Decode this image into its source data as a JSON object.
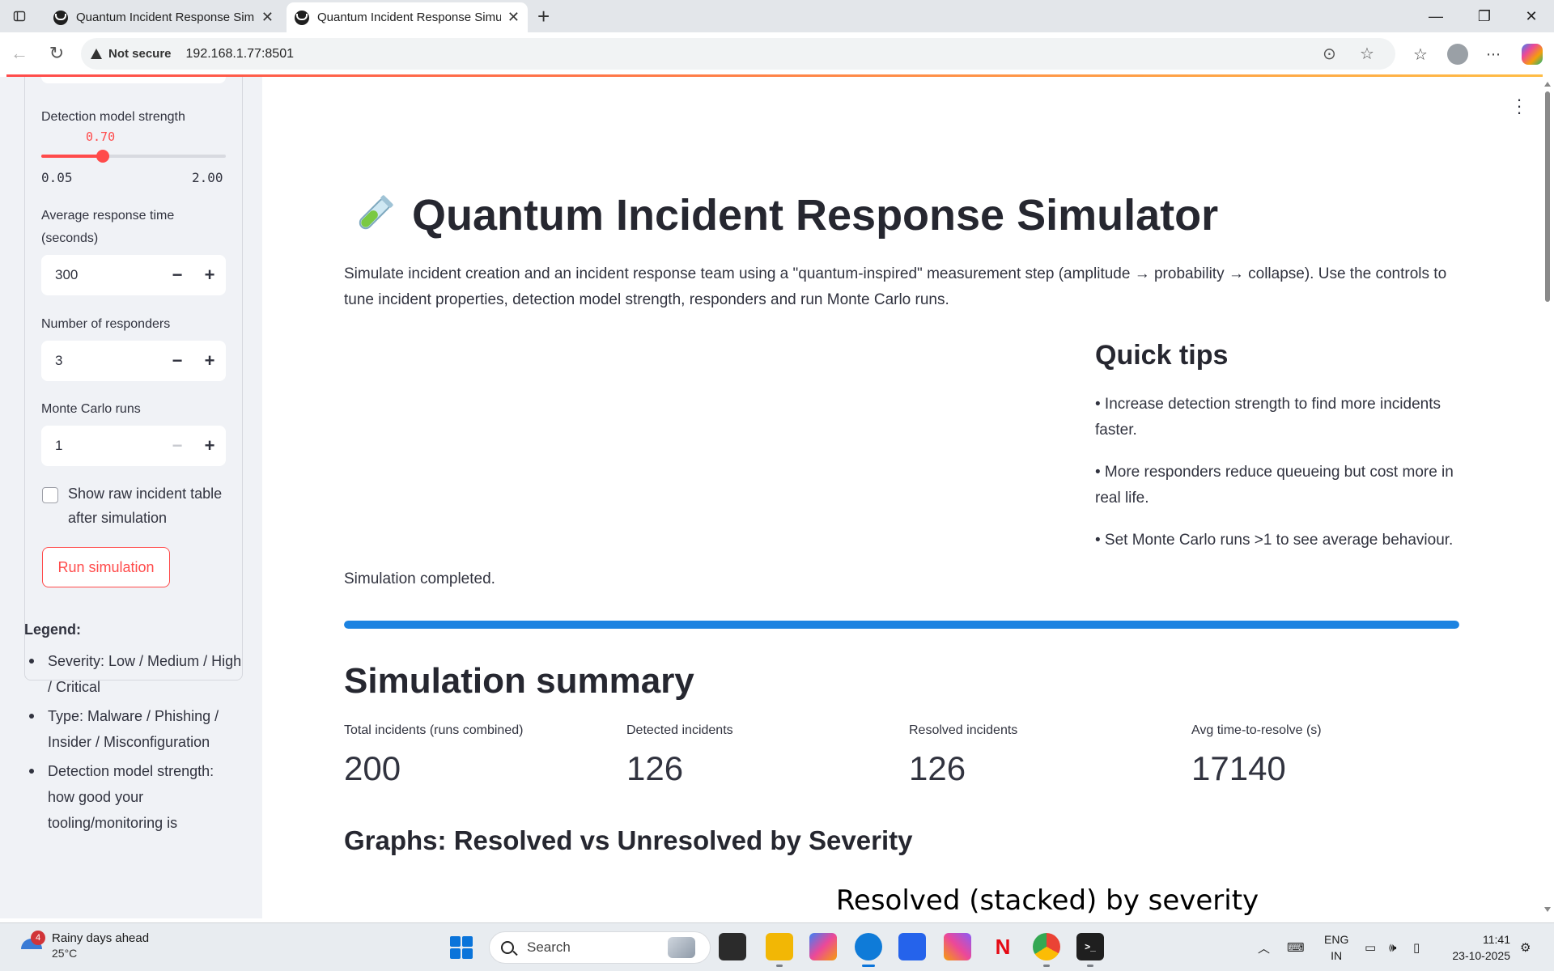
{
  "browser": {
    "tabs": [
      {
        "title": "Quantum Incident Response Simu",
        "active": false
      },
      {
        "title": "Quantum Incident Response Simu",
        "active": true
      }
    ],
    "security_label": "Not secure",
    "url": "192.168.1.77:8501"
  },
  "sidebar": {
    "detection_label": "Detection model strength",
    "detection_value": "0.70",
    "detection_numeric": 0.7,
    "detection_min": "0.05",
    "detection_max": "2.00",
    "detection_min_numeric": 0.05,
    "detection_max_numeric": 2.0,
    "response_time_label": "Average response time (seconds)",
    "response_time_value": "300",
    "responders_label": "Number of responders",
    "responders_value": "3",
    "monte_carlo_label": "Monte Carlo runs",
    "monte_carlo_value": "1",
    "checkbox_label": "Show raw incident table after simulation",
    "checkbox_checked": false,
    "run_button": "Run simulation",
    "legend_title": "Legend:",
    "legend_items": [
      "Severity: Low / Medium / High / Critical",
      "Type: Malware / Phishing / Insider / Misconfiguration",
      "Detection model strength: how good your tooling/monitoring is"
    ]
  },
  "main": {
    "title": "Quantum Incident Response Simulator",
    "intro": "Simulate incident creation and an incident response team using a \"quantum-inspired\" measurement step (amplitude → probability → collapse). Use the controls to tune incident properties, detection model strength, responders and run Monte Carlo runs.",
    "tips_title": "Quick tips",
    "tips": [
      "• Increase detection strength to find more incidents faster.",
      "• More responders reduce queueing but cost more in real life.",
      "• Set Monte Carlo runs >1 to see average behaviour."
    ],
    "status": "Simulation completed.",
    "progress": 1.0,
    "summary_title": "Simulation summary",
    "metrics": [
      {
        "label": "Total incidents (runs combined)",
        "value": "200"
      },
      {
        "label": "Detected incidents",
        "value": "126"
      },
      {
        "label": "Resolved incidents",
        "value": "126"
      },
      {
        "label": "Avg time-to-resolve (s)",
        "value": "17140"
      }
    ],
    "graphs_title": "Graphs: Resolved vs Unresolved by Severity",
    "chart_title": "Resolved (stacked) by severity"
  },
  "taskbar": {
    "weather_title": "Rainy days ahead",
    "weather_temp": "25°C",
    "weather_badge": "4",
    "search_placeholder": "Search",
    "lang_1": "ENG",
    "lang_2": "IN",
    "time": "11:41",
    "date": "23-10-2025"
  },
  "colors": {
    "accent": "#ff4b4b",
    "progress": "#1c83e1",
    "sidebar_bg": "#f0f2f6"
  }
}
